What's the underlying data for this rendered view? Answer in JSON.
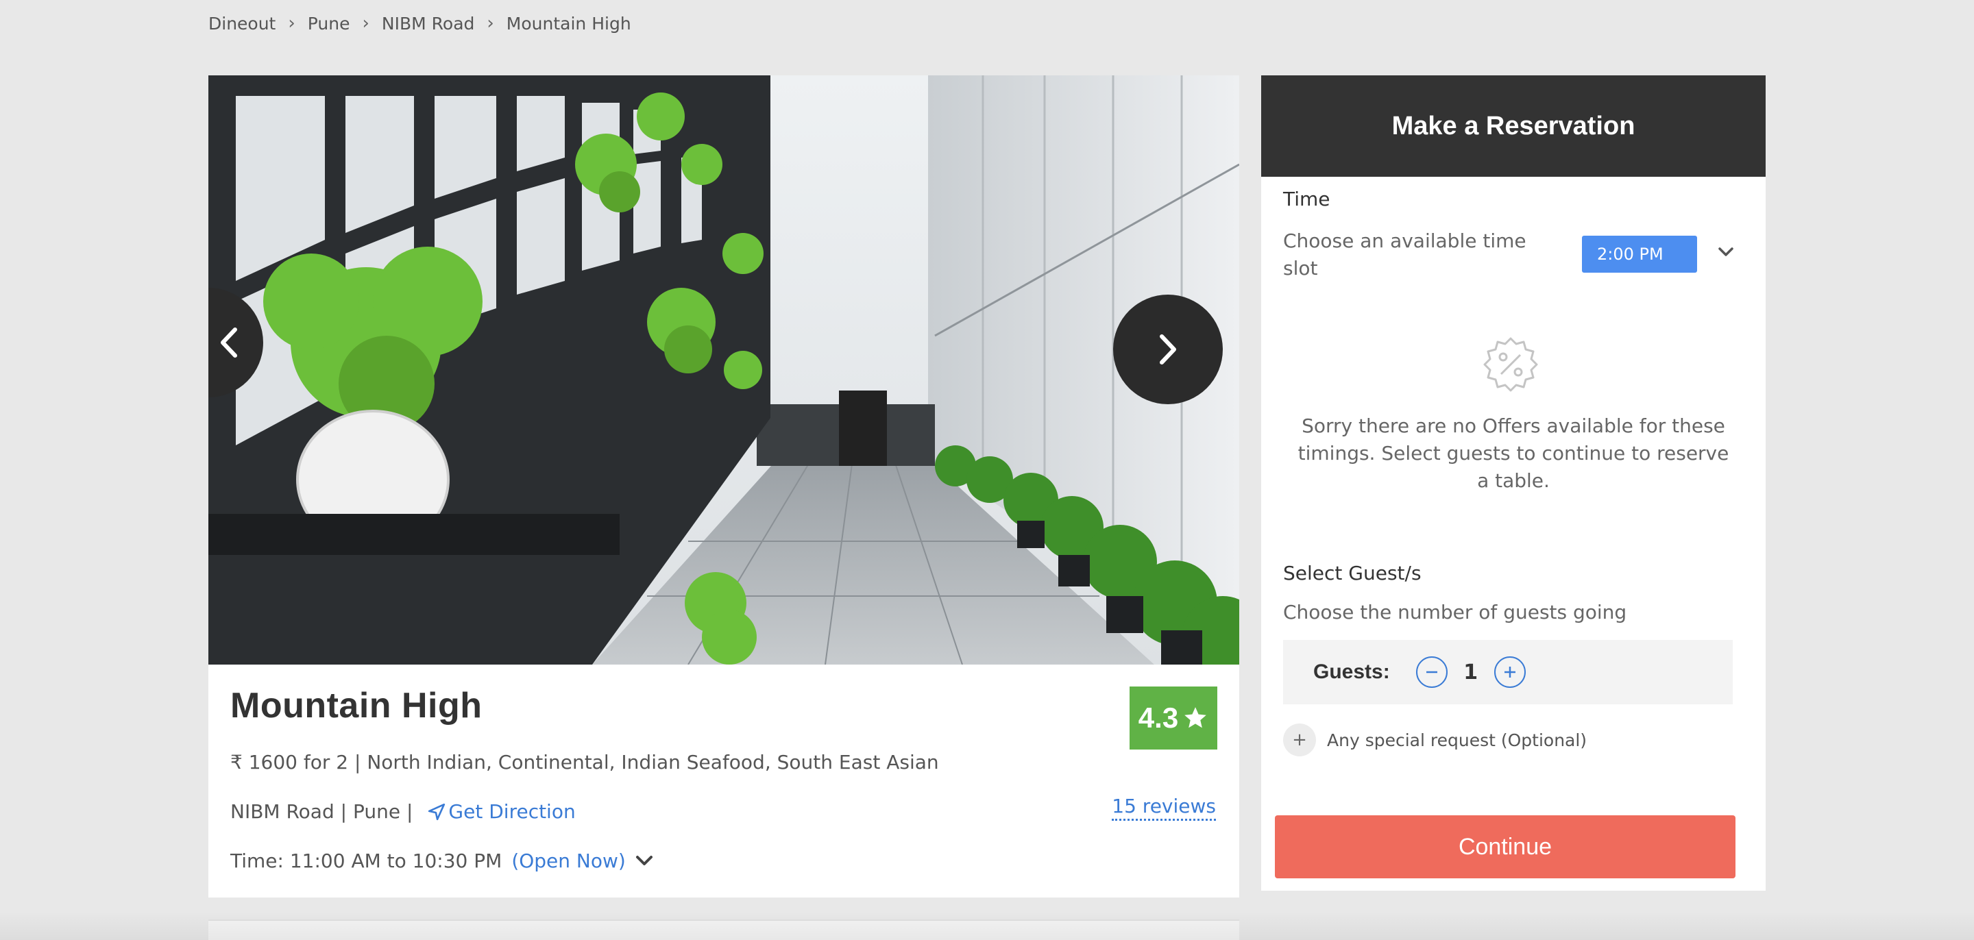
{
  "breadcrumb": [
    "Dineout",
    "Pune",
    "NIBM Road",
    "Mountain High"
  ],
  "restaurant": {
    "name": "Mountain High",
    "rating": "4.3",
    "cuisines_line": "₹ 1600 for 2 | North Indian, Continental, Indian Seafood, South East Asian",
    "location": "NIBM Road | Pune |",
    "direction_label": "Get Direction",
    "timing": "Time: 11:00 AM to 10:30 PM",
    "open_status": "(Open Now)",
    "reviews": "15 reviews"
  },
  "reservation": {
    "title": "Make a Reservation",
    "time_label": "Time",
    "time_hint": "Choose an available time slot",
    "selected_time": "2:00 PM",
    "no_offers": "Sorry there are no Offers available for these timings. Select guests to continue to reserve a table.",
    "guests_title": "Select Guest/s",
    "guests_hint": "Choose the number of guests going",
    "guests_label": "Guests:",
    "guest_count": "1",
    "special_request": "Any special request (Optional)",
    "continue_label": "Continue"
  },
  "colors": {
    "accent_blue": "#3a7bd5",
    "rating_green": "#60b246",
    "continue_red": "#ef6b5c",
    "header_dark": "#333333"
  },
  "icons": [
    "chevron-right-icon",
    "chevron-left-icon",
    "star-icon",
    "navigation-arrow-icon",
    "chevron-down-icon",
    "discount-badge-icon",
    "minus-icon",
    "plus-icon"
  ]
}
